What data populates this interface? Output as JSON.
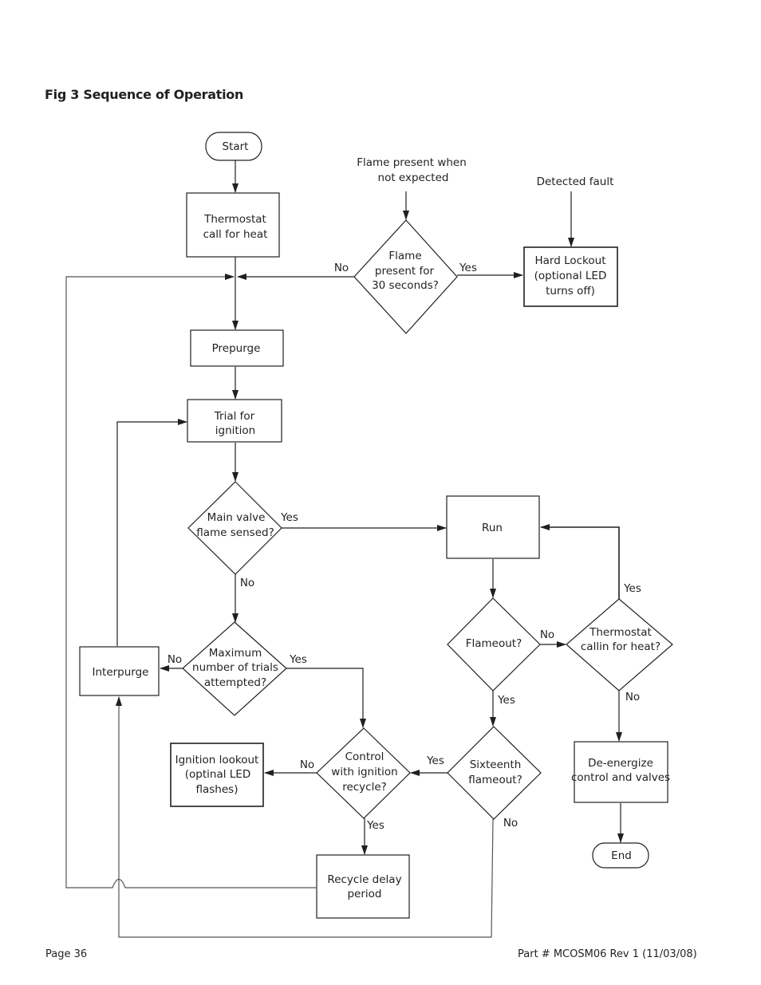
{
  "document": {
    "title": "Fig 3 Sequence of Operation",
    "footer_left": "Page 36",
    "footer_right": "Part # MCOSM06 Rev 1 (11/03/08)"
  },
  "diagram": {
    "nodes": {
      "start": {
        "type": "terminal",
        "lines": [
          "Start"
        ]
      },
      "thermostat_call": {
        "type": "process",
        "lines": [
          "Thermostat",
          "call for heat"
        ]
      },
      "flame_unexpected_note": {
        "type": "note",
        "lines": [
          "Flame present when",
          "not expected"
        ]
      },
      "detected_fault_note": {
        "type": "note",
        "lines": [
          "Detected fault"
        ]
      },
      "flame_30s": {
        "type": "decision",
        "lines": [
          "Flame",
          "present for",
          "30 seconds?"
        ]
      },
      "hard_lockout": {
        "type": "process",
        "lines": [
          "Hard Lockout",
          "(optional LED",
          "turns off)"
        ]
      },
      "prepurge": {
        "type": "process",
        "lines": [
          "Prepurge"
        ]
      },
      "trial_ignition": {
        "type": "process",
        "lines": [
          "Trial for",
          "ignition"
        ]
      },
      "main_valve": {
        "type": "decision",
        "lines": [
          "Main valve",
          "flame sensed?"
        ]
      },
      "run": {
        "type": "process",
        "lines": [
          "Run"
        ]
      },
      "max_trials": {
        "type": "decision",
        "lines": [
          "Maximum",
          "number of trials",
          "attempted?"
        ]
      },
      "interpurge": {
        "type": "process",
        "lines": [
          "Interpurge"
        ]
      },
      "flameout": {
        "type": "decision",
        "lines": [
          "Flameout?"
        ]
      },
      "thermostat_calling": {
        "type": "decision",
        "lines": [
          "Thermostat",
          "callin for heat?"
        ]
      },
      "ignition_lockout": {
        "type": "process",
        "lines": [
          "Ignition lookout",
          "(optinal LED",
          "flashes)"
        ]
      },
      "control_recycle": {
        "type": "decision",
        "lines": [
          "Control",
          "with ignition",
          "recycle?"
        ]
      },
      "sixteenth_flameout": {
        "type": "decision",
        "lines": [
          "Sixteenth",
          "flameout?"
        ]
      },
      "deenergize": {
        "type": "process",
        "lines": [
          "De-energize",
          "control and valves"
        ]
      },
      "recycle_delay": {
        "type": "process",
        "lines": [
          "Recycle delay",
          "period"
        ]
      },
      "end": {
        "type": "terminal",
        "lines": [
          "End"
        ]
      }
    },
    "edge_labels": {
      "flame_30s_no": "No",
      "flame_30s_yes": "Yes",
      "main_valve_yes": "Yes",
      "main_valve_no": "No",
      "max_trials_no": "No",
      "max_trials_yes": "Yes",
      "flameout_no": "No",
      "flameout_yes": "Yes",
      "thermostat_calling_yes": "Yes",
      "thermostat_calling_no": "No",
      "control_recycle_no": "No",
      "control_recycle_yes": "Yes",
      "sixteenth_yes": "Yes",
      "sixteenth_no": "No"
    },
    "edges": [
      {
        "from": "start",
        "to": "thermostat_call"
      },
      {
        "from": "thermostat_call",
        "to": "prepurge"
      },
      {
        "from": "flame_unexpected_note",
        "to": "flame_30s"
      },
      {
        "from": "flame_30s",
        "to": "prepurge",
        "label": "No"
      },
      {
        "from": "flame_30s",
        "to": "hard_lockout",
        "label": "Yes"
      },
      {
        "from": "detected_fault_note",
        "to": "hard_lockout"
      },
      {
        "from": "prepurge",
        "to": "trial_ignition"
      },
      {
        "from": "trial_ignition",
        "to": "main_valve"
      },
      {
        "from": "main_valve",
        "to": "run",
        "label": "Yes"
      },
      {
        "from": "main_valve",
        "to": "max_trials",
        "label": "No"
      },
      {
        "from": "max_trials",
        "to": "interpurge",
        "label": "No"
      },
      {
        "from": "max_trials",
        "to": "control_recycle",
        "label": "Yes"
      },
      {
        "from": "interpurge",
        "to": "trial_ignition"
      },
      {
        "from": "run",
        "to": "flameout"
      },
      {
        "from": "flameout",
        "to": "thermostat_calling",
        "label": "No"
      },
      {
        "from": "flameout",
        "to": "sixteenth_flameout",
        "label": "Yes"
      },
      {
        "from": "thermostat_calling",
        "to": "run",
        "label": "Yes"
      },
      {
        "from": "thermostat_calling",
        "to": "deenergize",
        "label": "No"
      },
      {
        "from": "deenergize",
        "to": "end"
      },
      {
        "from": "sixteenth_flameout",
        "to": "control_recycle",
        "label": "Yes"
      },
      {
        "from": "sixteenth_flameout",
        "to": "interpurge",
        "label": "No"
      },
      {
        "from": "control_recycle",
        "to": "ignition_lockout",
        "label": "No"
      },
      {
        "from": "control_recycle",
        "to": "recycle_delay",
        "label": "Yes"
      },
      {
        "from": "recycle_delay",
        "to": "prepurge"
      }
    ]
  }
}
